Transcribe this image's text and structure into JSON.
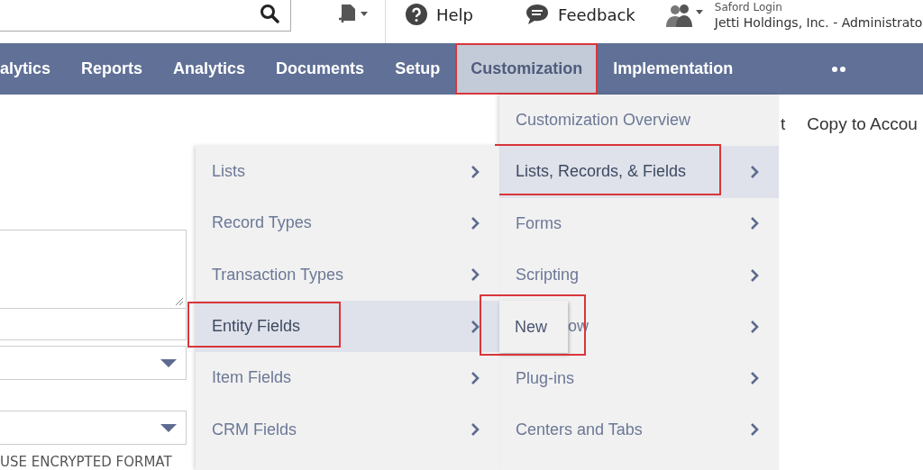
{
  "header": {
    "user_name": "Saford Login",
    "account": "Jetti Holdings, Inc. - Administrato",
    "help": "Help",
    "feedback": "Feedback"
  },
  "nav": [
    {
      "label": "alytics",
      "selected": false,
      "annotated": false
    },
    {
      "label": "Reports",
      "selected": false,
      "annotated": false
    },
    {
      "label": "Analytics",
      "selected": false,
      "annotated": false
    },
    {
      "label": "Documents",
      "selected": false,
      "annotated": false
    },
    {
      "label": "Setup",
      "selected": false,
      "annotated": false
    },
    {
      "label": "Customization",
      "selected": true,
      "annotated": true
    },
    {
      "label": "Implementation",
      "selected": false,
      "annotated": false
    }
  ],
  "page": {
    "actions": [
      "t",
      "Copy to Accou"
    ],
    "encrypted_label": "USE ENCRYPTED FORMAT"
  },
  "menu": [
    {
      "label": "Customization Overview",
      "submenu": false,
      "selected": false,
      "annotated": false,
      "covered": false
    },
    {
      "label": "Lists, Records, & Fields",
      "submenu": true,
      "selected": true,
      "annotated": true,
      "covered": false
    },
    {
      "label": "Forms",
      "submenu": true,
      "selected": false,
      "annotated": false,
      "covered": false
    },
    {
      "label": "Scripting",
      "submenu": true,
      "selected": false,
      "annotated": false,
      "covered": false
    },
    {
      "label": "ow",
      "submenu": true,
      "selected": false,
      "annotated": false,
      "covered": true
    },
    {
      "label": "Plug-ins",
      "submenu": true,
      "selected": false,
      "annotated": false,
      "covered": false
    },
    {
      "label": "Centers and Tabs",
      "submenu": true,
      "selected": false,
      "annotated": false,
      "covered": false
    }
  ],
  "submenu": [
    {
      "label": "Lists",
      "selected": false,
      "annotated": false
    },
    {
      "label": "Record Types",
      "selected": false,
      "annotated": false
    },
    {
      "label": "Transaction Types",
      "selected": false,
      "annotated": false
    },
    {
      "label": "Entity Fields",
      "selected": true,
      "annotated": true
    },
    {
      "label": "Item Fields",
      "selected": false,
      "annotated": false
    },
    {
      "label": "CRM Fields",
      "selected": false,
      "annotated": false
    }
  ],
  "flyout": {
    "label": "New",
    "annotated": true
  }
}
